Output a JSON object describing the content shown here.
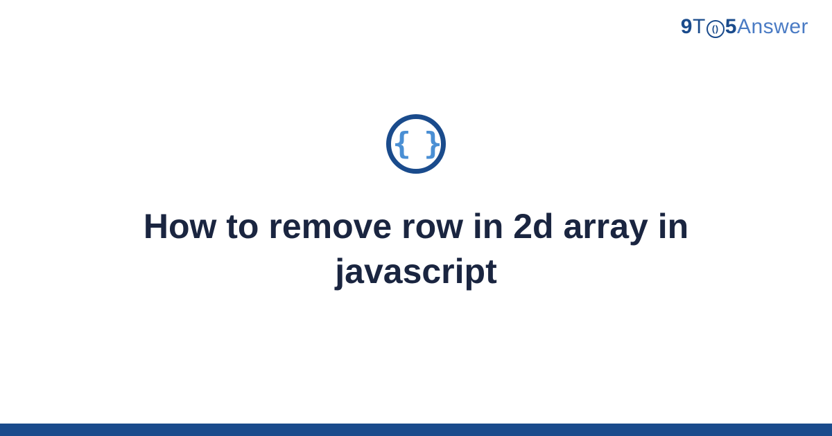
{
  "logo": {
    "nine": "9",
    "to_letter": "T",
    "circle_text": "()",
    "five": "5",
    "answer": "Answer"
  },
  "icon": {
    "braces": "{ }"
  },
  "title": "How to remove row in 2d array in javascript",
  "colors": {
    "primary": "#1a4b8c",
    "accent": "#4a8fd4",
    "text": "#1a2540"
  }
}
